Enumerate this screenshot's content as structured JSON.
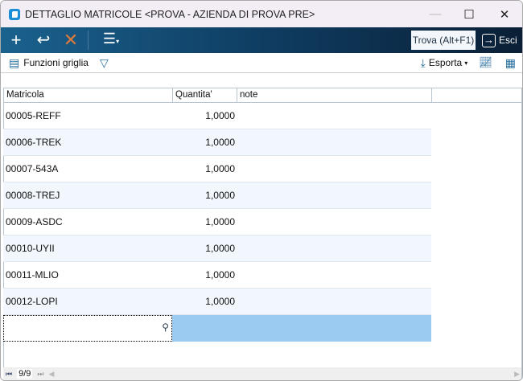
{
  "title": "DETTAGLIO MATRICOLE <PROVA - AZIENDA DI PROVA PRE>",
  "toolbar": {
    "find": "Trova (Alt+F1)",
    "exit": "Esci"
  },
  "subbar": {
    "grid_functions": "Funzioni griglia",
    "export": "Esporta"
  },
  "columns": [
    "Matricola",
    "Quantita'",
    "note"
  ],
  "rows": [
    {
      "matricola": "00005-REFF",
      "quantita": "1,0000",
      "note": ""
    },
    {
      "matricola": "00006-TREK",
      "quantita": "1,0000",
      "note": ""
    },
    {
      "matricola": "00007-543A",
      "quantita": "1,0000",
      "note": ""
    },
    {
      "matricola": "00008-TREJ",
      "quantita": "1,0000",
      "note": ""
    },
    {
      "matricola": "00009-ASDC",
      "quantita": "1,0000",
      "note": ""
    },
    {
      "matricola": "00010-UYII",
      "quantita": "1,0000",
      "note": ""
    },
    {
      "matricola": "00011-MLIO",
      "quantita": "1,0000",
      "note": ""
    },
    {
      "matricola": "00012-LOPI",
      "quantita": "1,0000",
      "note": ""
    }
  ],
  "footer": {
    "pager": "9/9"
  }
}
